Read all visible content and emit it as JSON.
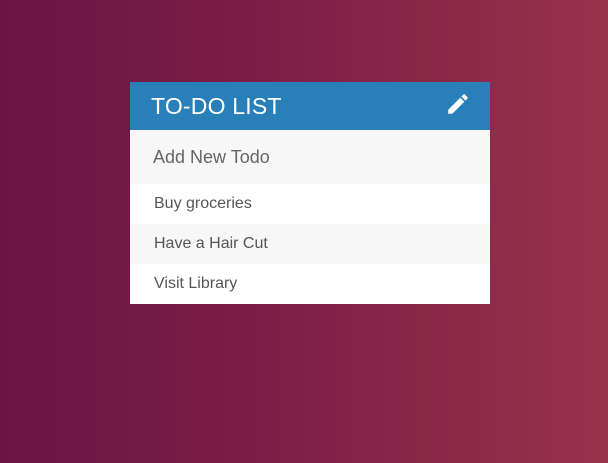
{
  "card": {
    "title": "TO-DO LIST",
    "edit_icon": "pencil-icon"
  },
  "add_todo": {
    "placeholder": "Add New Todo"
  },
  "todos": [
    {
      "label": "Buy groceries"
    },
    {
      "label": "Have a Hair Cut"
    },
    {
      "label": "Visit Library"
    }
  ],
  "colors": {
    "header": "#2980b9",
    "background_start": "#6b1544",
    "background_end": "#99324a"
  }
}
